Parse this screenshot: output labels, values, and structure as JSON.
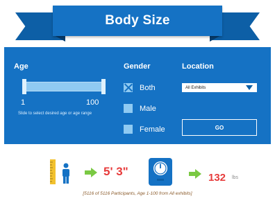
{
  "header": {
    "title": "Body Size"
  },
  "filters": {
    "age": {
      "label": "Age",
      "min_label": "1",
      "max_label": "100",
      "hint": "Slide to select desired age or age range",
      "range": [
        1,
        100
      ]
    },
    "gender": {
      "label": "Gender",
      "options": [
        {
          "label": "Both",
          "checked": true
        },
        {
          "label": "Male",
          "checked": false
        },
        {
          "label": "Female",
          "checked": false
        }
      ]
    },
    "location": {
      "label": "Location",
      "selected": "All Exhibits"
    },
    "go_label": "GO"
  },
  "result": {
    "height": "5' 3\"",
    "weight": "132",
    "weight_unit": "lbs",
    "participants": "[5116 of 5116 Participants, Age 1-100 from All exhibits]"
  },
  "colors": {
    "panel": "#1572c4",
    "ribbon_dark": "#0d5fa6",
    "slider_light": "#8fcaf2",
    "value_red": "#e73b3b",
    "arrow_green": "#7ac943",
    "ruler_yellow": "#f2c12e"
  },
  "icons": [
    "ruler-icon",
    "person-icon",
    "arrow-right-icon",
    "scale-icon",
    "caret-down-icon",
    "check-x-icon"
  ]
}
